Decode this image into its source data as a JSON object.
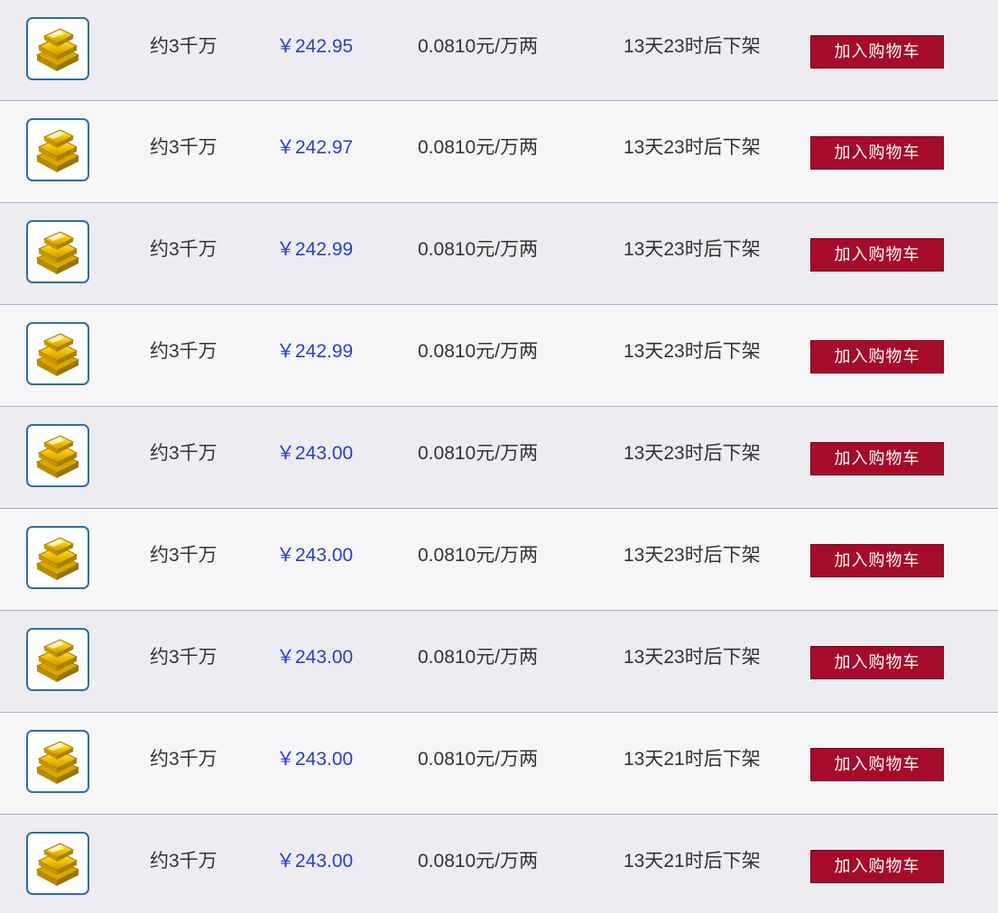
{
  "listings": [
    {
      "icon": "gold-bars-icon",
      "amount": "约3千万",
      "price": "￥242.95",
      "rate": "0.0810元/万两",
      "expires": "13天23时后下架",
      "action": "加入购物车"
    },
    {
      "icon": "gold-bars-icon",
      "amount": "约3千万",
      "price": "￥242.97",
      "rate": "0.0810元/万两",
      "expires": "13天23时后下架",
      "action": "加入购物车"
    },
    {
      "icon": "gold-bars-icon",
      "amount": "约3千万",
      "price": "￥242.99",
      "rate": "0.0810元/万两",
      "expires": "13天23时后下架",
      "action": "加入购物车"
    },
    {
      "icon": "gold-bars-icon",
      "amount": "约3千万",
      "price": "￥242.99",
      "rate": "0.0810元/万两",
      "expires": "13天23时后下架",
      "action": "加入购物车"
    },
    {
      "icon": "gold-bars-icon",
      "amount": "约3千万",
      "price": "￥243.00",
      "rate": "0.0810元/万两",
      "expires": "13天23时后下架",
      "action": "加入购物车"
    },
    {
      "icon": "gold-bars-icon",
      "amount": "约3千万",
      "price": "￥243.00",
      "rate": "0.0810元/万两",
      "expires": "13天23时后下架",
      "action": "加入购物车"
    },
    {
      "icon": "gold-bars-icon",
      "amount": "约3千万",
      "price": "￥243.00",
      "rate": "0.0810元/万两",
      "expires": "13天23时后下架",
      "action": "加入购物车"
    },
    {
      "icon": "gold-bars-icon",
      "amount": "约3千万",
      "price": "￥243.00",
      "rate": "0.0810元/万两",
      "expires": "13天21时后下架",
      "action": "加入购物车"
    },
    {
      "icon": "gold-bars-icon",
      "amount": "约3千万",
      "price": "￥243.00",
      "rate": "0.0810元/万两",
      "expires": "13天21时后下架",
      "action": "加入购物车"
    }
  ],
  "colors": {
    "price_text": "#2a3fc4",
    "button_bg": "#a50b2a",
    "row_divider": "#9fb3d6",
    "icon_border": "#2f6f9f",
    "gold": "#f2c200"
  }
}
